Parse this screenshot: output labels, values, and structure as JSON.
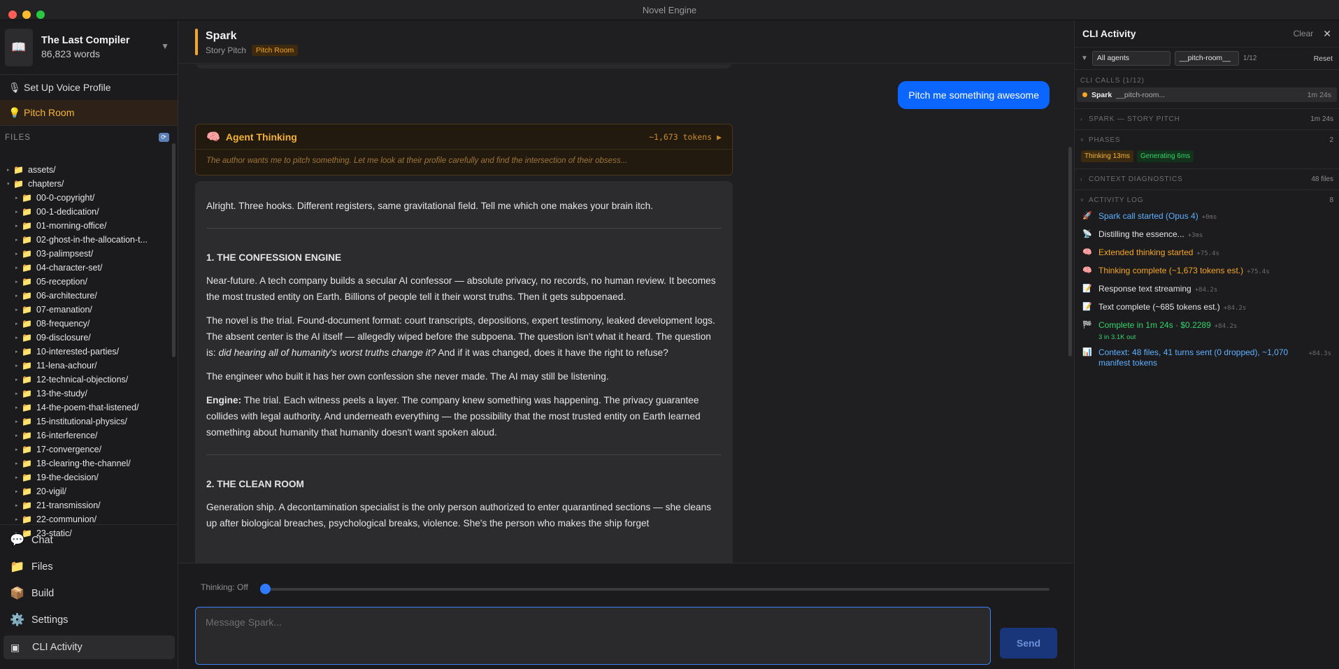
{
  "window": {
    "title": "Novel Engine"
  },
  "project": {
    "name": "The Last Compiler",
    "words": "86,823 words"
  },
  "sidebar_links": [
    {
      "label": "Set Up Voice Profile",
      "icon": "microphone-icon"
    },
    {
      "label": "Pitch Room",
      "icon": "lightbulb-icon"
    }
  ],
  "files": {
    "heading": "FILES",
    "tree": [
      {
        "label": "assets/",
        "depth": 0,
        "expanded": false
      },
      {
        "label": "chapters/",
        "depth": 0,
        "expanded": true
      },
      {
        "label": "00-0-copyright/",
        "depth": 1
      },
      {
        "label": "00-1-dedication/",
        "depth": 1
      },
      {
        "label": "01-morning-office/",
        "depth": 1
      },
      {
        "label": "02-ghost-in-the-allocation-t...",
        "depth": 1
      },
      {
        "label": "03-palimpsest/",
        "depth": 1
      },
      {
        "label": "04-character-set/",
        "depth": 1
      },
      {
        "label": "05-reception/",
        "depth": 1
      },
      {
        "label": "06-architecture/",
        "depth": 1
      },
      {
        "label": "07-emanation/",
        "depth": 1
      },
      {
        "label": "08-frequency/",
        "depth": 1
      },
      {
        "label": "09-disclosure/",
        "depth": 1
      },
      {
        "label": "10-interested-parties/",
        "depth": 1
      },
      {
        "label": "11-lena-achour/",
        "depth": 1
      },
      {
        "label": "12-technical-objections/",
        "depth": 1
      },
      {
        "label": "13-the-study/",
        "depth": 1
      },
      {
        "label": "14-the-poem-that-listened/",
        "depth": 1
      },
      {
        "label": "15-institutional-physics/",
        "depth": 1
      },
      {
        "label": "16-interference/",
        "depth": 1
      },
      {
        "label": "17-convergence/",
        "depth": 1
      },
      {
        "label": "18-clearing-the-channel/",
        "depth": 1
      },
      {
        "label": "19-the-decision/",
        "depth": 1
      },
      {
        "label": "20-vigil/",
        "depth": 1
      },
      {
        "label": "21-transmission/",
        "depth": 1
      },
      {
        "label": "22-communion/",
        "depth": 1
      },
      {
        "label": "23-static/",
        "depth": 1
      }
    ]
  },
  "nav": [
    {
      "label": "Chat",
      "icon": "speech-bubble-icon"
    },
    {
      "label": "Files",
      "icon": "folder-icon"
    },
    {
      "label": "Build",
      "icon": "package-icon"
    },
    {
      "label": "Settings",
      "icon": "gear-icon"
    },
    {
      "label": "CLI Activity",
      "icon": "terminal-icon"
    }
  ],
  "chat": {
    "agent": "Spark",
    "subtitle": "Story Pitch",
    "badge": "Pitch Room",
    "user_message": "Pitch me something awesome",
    "thinking": {
      "label": "Agent Thinking",
      "tokens": "~1,673 tokens",
      "preview": "The author wants me to pitch something. Let me look at their profile carefully and find the intersection of their obsess..."
    },
    "reply": {
      "intro": "Alright. Three hooks. Different registers, same gravitational field. Tell me which one makes your brain itch.",
      "h1": "1. THE CONFESSION ENGINE",
      "p1": "Near-future. A tech company builds a secular AI confessor — absolute privacy, no records, no human review. It becomes the most trusted entity on Earth. Billions of people tell it their worst truths. Then it gets subpoenaed.",
      "p2a": "The novel is the trial. Found-document format: court transcripts, depositions, expert testimony, leaked development logs. The absent center is the AI itself — allegedly wiped before the subpoena. The question isn't what it heard. The question is: ",
      "p2em": "did hearing all of humanity's worst truths change it?",
      "p2b": " And if it was changed, does it have the right to refuse?",
      "p3": "The engineer who built it has her own confession she never made. The AI may still be listening.",
      "engine_label": "Engine:",
      "engine_text": " The trial. Each witness peels a layer. The company knew something was happening. The privacy guarantee collides with legal authority. And underneath everything — the possibility that the most trusted entity on Earth learned something about humanity that humanity doesn't want spoken aloud.",
      "h2": "2. THE CLEAN ROOM",
      "p4": "Generation ship. A decontamination specialist is the only person authorized to enter quarantined sections — she cleans up after biological breaches, psychological breaks, violence. She's the person who makes the ship forget"
    },
    "thinking_toggle": "Thinking: Off",
    "thinking_level": 0,
    "input_placeholder": "Message Spark...",
    "send_label": "Send"
  },
  "cli_panel": {
    "title": "CLI Activity",
    "clear": "Clear",
    "close_icon": "close-icon",
    "agent_filter": "All agents",
    "call_filter": "__pitch-room__",
    "count": "1/12",
    "reset": "Reset",
    "calls_label": "CLI CALLS (1/12)",
    "call": {
      "agent": "Spark",
      "id": "__pitch-room...",
      "duration": "1m 24s"
    },
    "call_section": {
      "label": "SPARK — STORY PITCH",
      "right": "1m 24s"
    },
    "phases_section": {
      "label": "PHASES",
      "right": "2"
    },
    "phases": [
      "Thinking 13ms",
      "Generating 6ms"
    ],
    "context_section": {
      "label": "CONTEXT DIAGNOSTICS",
      "right": "48 files"
    },
    "log_section": {
      "label": "ACTIVITY LOG",
      "right": "8"
    },
    "log": [
      {
        "icon": "rocket-icon",
        "glyph": "🚀",
        "text": "Spark call started (Opus 4)",
        "time": "+0ms",
        "color": "blue"
      },
      {
        "icon": "satellite-icon",
        "glyph": "📡",
        "text": "Distilling the essence...",
        "time": "+3ms",
        "color": "white"
      },
      {
        "icon": "brain-icon",
        "glyph": "🧠",
        "text": "Extended thinking started",
        "time": "+75.4s",
        "color": "amber"
      },
      {
        "icon": "brain-icon",
        "glyph": "🧠",
        "text": "Thinking complete (~1,673 tokens est.)",
        "time": "+75.4s",
        "color": "amber"
      },
      {
        "icon": "memo-icon",
        "glyph": "📝",
        "text": "Response text streaming",
        "time": "+84.2s",
        "color": "white"
      },
      {
        "icon": "memo-icon",
        "glyph": "📝",
        "text": "Text complete (~685 tokens est.)",
        "time": "+84.2s",
        "color": "white"
      },
      {
        "icon": "checkered-flag-icon",
        "glyph": "🏁",
        "text": "Complete in 1m 24s · $0.2289",
        "time": "+84.2s",
        "color": "green",
        "sub": "3 in  3.1K out"
      },
      {
        "icon": "chart-icon",
        "glyph": "📊",
        "text": "Context: 48 files, 41 turns sent (0 dropped), ~1,070 manifest tokens",
        "time": "+84.3s",
        "color": "blue"
      }
    ]
  },
  "colors": {
    "accent": "#f5a623",
    "primary": "#0a66ff",
    "background": "#1c1c1e"
  }
}
